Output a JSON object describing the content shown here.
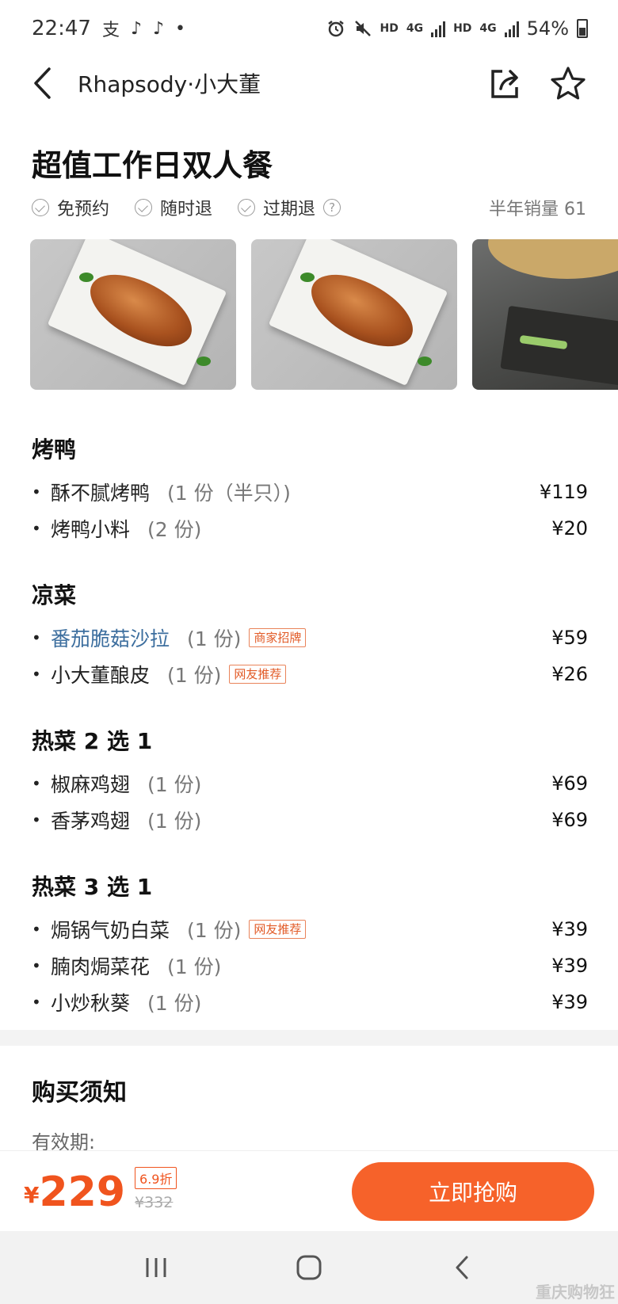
{
  "status_bar": {
    "time": "22:47",
    "app_icons": [
      "支",
      "♪",
      "♪",
      "•"
    ],
    "hd1": "HD",
    "net1": "4G",
    "hd2": "HD",
    "net2": "4G",
    "battery": "54%"
  },
  "header": {
    "title": "Rhapsody·小大董"
  },
  "deal": {
    "title": "超值工作日双人餐",
    "tags": [
      "免预约",
      "随时退",
      "过期退"
    ],
    "help": "?",
    "sales": "半年销量 61"
  },
  "menu": {
    "sections": [
      {
        "title": "烤鸭",
        "items": [
          {
            "name": "酥不腻烤鸭",
            "qty": "(1 份（半只）)",
            "price": "¥119"
          },
          {
            "name": "烤鸭小料",
            "qty": "(2 份)",
            "price": "¥20"
          }
        ]
      },
      {
        "title": "凉菜",
        "items": [
          {
            "name": "番茄脆菇沙拉",
            "qty": "(1 份)",
            "badge": "商家招牌",
            "price": "¥59"
          },
          {
            "name": "小大董酿皮",
            "qty": "(1 份)",
            "badge": "网友推荐",
            "price": "¥26"
          }
        ]
      },
      {
        "title": "热菜 2 选 1",
        "items": [
          {
            "name": "椒麻鸡翅",
            "qty": "(1 份)",
            "price": "¥69"
          },
          {
            "name": "香茅鸡翅",
            "qty": "(1 份)",
            "price": "¥69"
          }
        ]
      },
      {
        "title": "热菜 3 选 1",
        "items": [
          {
            "name": "焗锅气奶白菜",
            "qty": "(1 份)",
            "badge": "网友推荐",
            "price": "¥39"
          },
          {
            "name": "腩肉焗菜花",
            "qty": "(1 份)",
            "price": "¥39"
          },
          {
            "name": "小炒秋葵",
            "qty": "(1 份)",
            "price": "¥39"
          }
        ]
      }
    ]
  },
  "notice": {
    "title": "购买须知",
    "validity_label": "有效期:"
  },
  "buy_bar": {
    "currency": "¥",
    "price": "229",
    "discount": "6.9折",
    "original_price": "¥332",
    "button": "立即抢购"
  },
  "watermark": "重庆购物狂",
  "colors": {
    "accent": "#f6622a",
    "price": "#f0541e",
    "link": "#3c6e9e"
  }
}
